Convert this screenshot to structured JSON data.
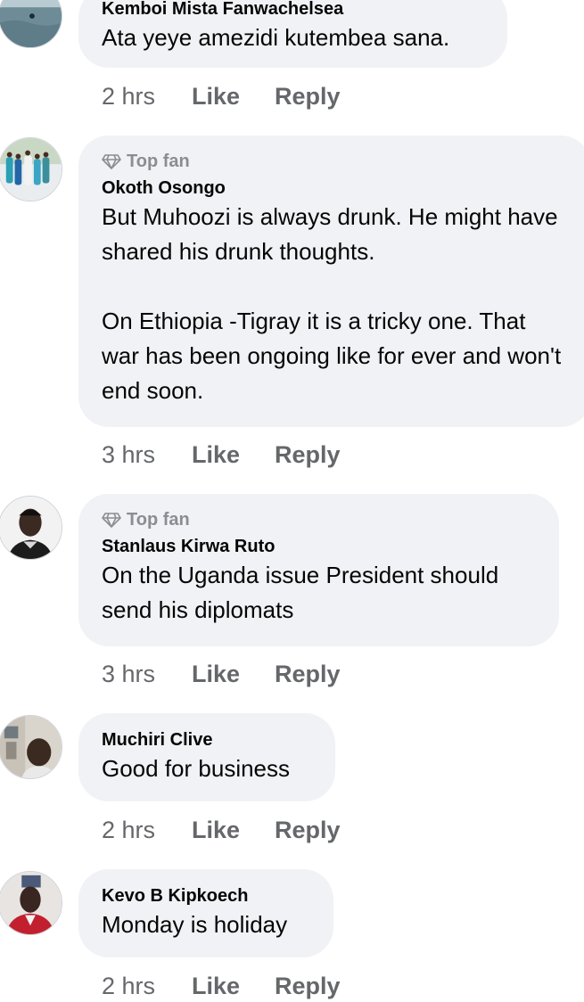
{
  "comments": [
    {
      "author": "Kemboi Mista Fanwachelsea",
      "badge": "",
      "text": "Ata yeye amezidi kutembea sana.",
      "time": "2 hrs",
      "like_label": "Like",
      "reply_label": "Reply"
    },
    {
      "author": "Okoth Osongo",
      "badge": "Top fan",
      "text": "But Muhoozi is always drunk. He might have shared his drunk thoughts.\n\nOn Ethiopia -Tigray it is a tricky one. That war has been ongoing like for ever and won't end soon.",
      "time": "3 hrs",
      "like_label": "Like",
      "reply_label": "Reply"
    },
    {
      "author": "Stanlaus Kirwa Ruto",
      "badge": "Top fan",
      "text": "On the Uganda issue President should send his diplomats",
      "time": "3 hrs",
      "like_label": "Like",
      "reply_label": "Reply"
    },
    {
      "author": "Muchiri Clive",
      "badge": "",
      "text": "Good for business",
      "time": "2 hrs",
      "like_label": "Like",
      "reply_label": "Reply"
    },
    {
      "author": "Kevo B Kipkoech",
      "badge": "",
      "text": "Monday is holiday",
      "time": "2 hrs",
      "like_label": "Like",
      "reply_label": "Reply"
    }
  ],
  "badge_icon": "diamond-icon"
}
